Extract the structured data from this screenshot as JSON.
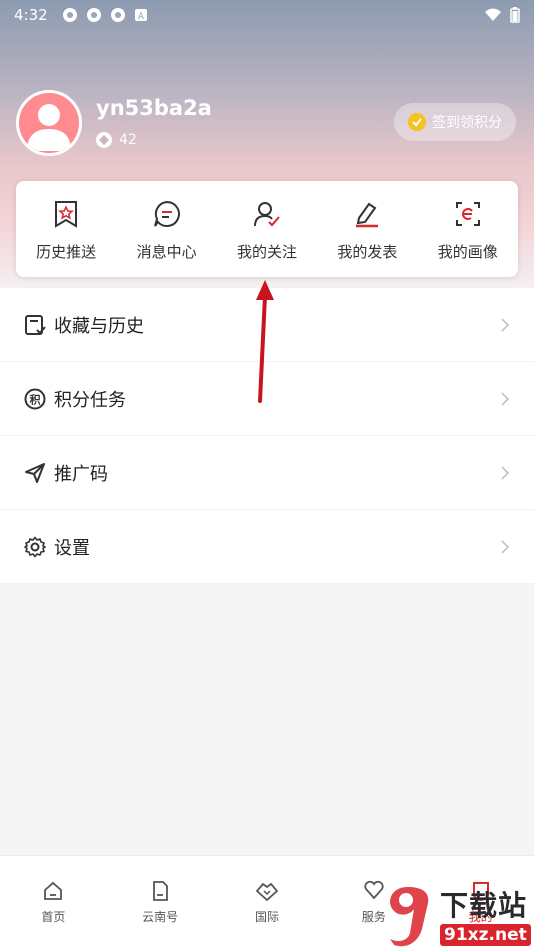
{
  "status_bar": {
    "time": "4:32"
  },
  "profile": {
    "username": "yn53ba2a",
    "points": "42"
  },
  "signin": {
    "label": "签到领积分"
  },
  "quick_actions": [
    {
      "label": "历史推送",
      "icon": "bookmark-star-icon"
    },
    {
      "label": "消息中心",
      "icon": "chat-bubble-icon"
    },
    {
      "label": "我的关注",
      "icon": "user-check-icon"
    },
    {
      "label": "我的发表",
      "icon": "edit-pen-icon"
    },
    {
      "label": "我的画像",
      "icon": "profile-scan-icon"
    }
  ],
  "menu": [
    {
      "label": "收藏与历史",
      "icon": "favorite-history-icon"
    },
    {
      "label": "积分任务",
      "icon": "points-icon"
    },
    {
      "label": "推广码",
      "icon": "send-icon"
    },
    {
      "label": "设置",
      "icon": "gear-icon"
    }
  ],
  "bottom_nav": [
    {
      "label": "首页",
      "icon": "home-icon"
    },
    {
      "label": "云南号",
      "icon": "document-icon"
    },
    {
      "label": "国际",
      "icon": "handshake-icon"
    },
    {
      "label": "服务",
      "icon": "service-icon"
    },
    {
      "label": "我的",
      "icon": "profile-icon"
    }
  ],
  "colors": {
    "accent": "#d6282f",
    "avatar": "#ff8a8f",
    "coin": "#f4c320"
  }
}
